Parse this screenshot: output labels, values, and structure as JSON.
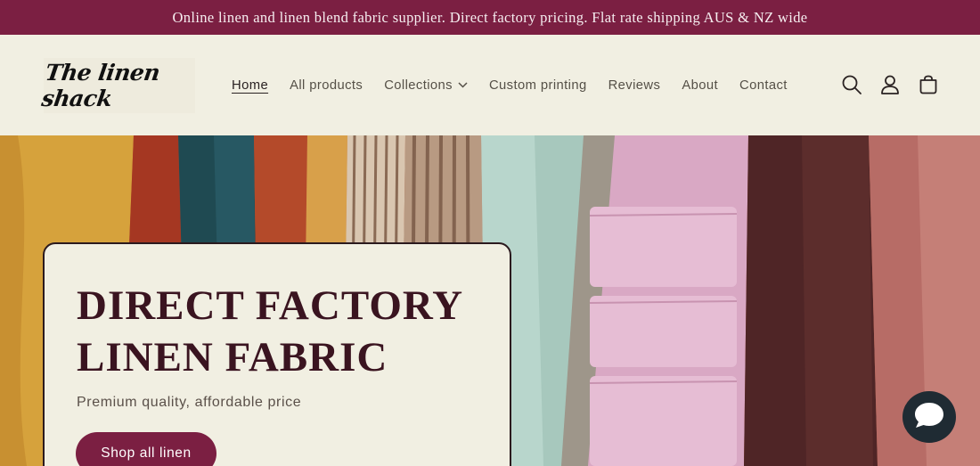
{
  "announcement": {
    "text": "Online linen and linen blend fabric supplier. Direct factory pricing. Flat rate shipping AUS & NZ wide"
  },
  "header": {
    "logo_text": "The linen shack",
    "nav": [
      {
        "label": "Home",
        "active": true
      },
      {
        "label": "All products"
      },
      {
        "label": "Collections",
        "has_dropdown": true
      },
      {
        "label": "Custom printing"
      },
      {
        "label": "Reviews"
      },
      {
        "label": "About"
      },
      {
        "label": "Contact"
      }
    ],
    "icons": [
      "search-icon",
      "account-icon",
      "cart-icon"
    ]
  },
  "hero": {
    "title": "DIRECT FACTORY LINEN FABRIC",
    "subtitle": "Premium quality, affordable price",
    "button_label": "Shop all linen"
  },
  "colors": {
    "brand": "#7b1f42",
    "background": "#f1efe2",
    "heading": "#3a1420",
    "chat": "#1f2b33"
  },
  "chat_widget": {
    "icon": "chat-bubble-icon"
  }
}
